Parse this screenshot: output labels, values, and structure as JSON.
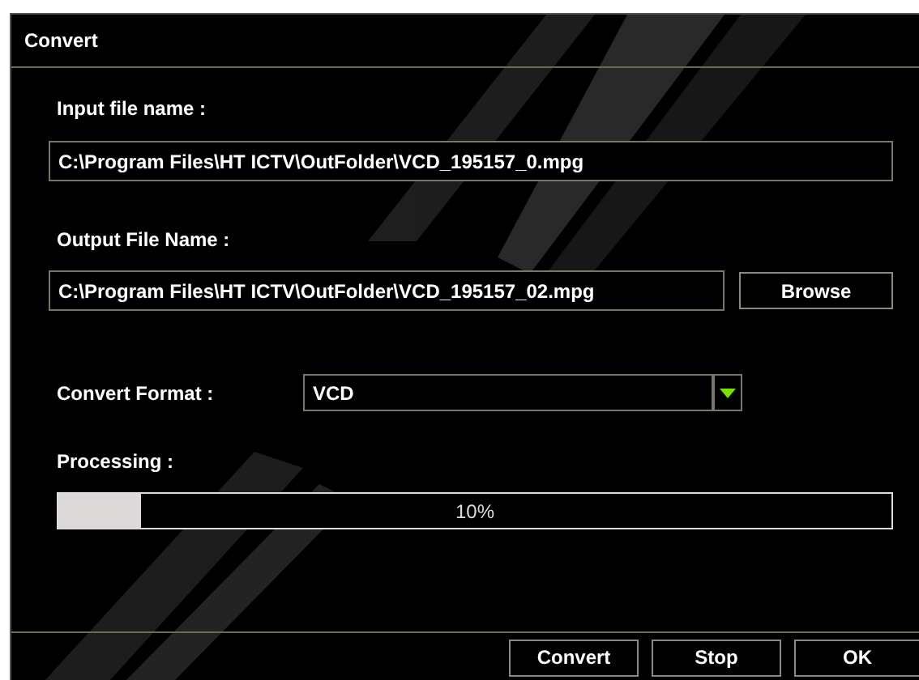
{
  "window": {
    "title": "Convert"
  },
  "input_file": {
    "label": "Input file name :",
    "value": "C:\\Program Files\\HT ICTV\\OutFolder\\VCD_195157_0.mpg"
  },
  "output_file": {
    "label": "Output File Name :",
    "value": "C:\\Program Files\\HT ICTV\\OutFolder\\VCD_195157_02.mpg",
    "button": "Browse"
  },
  "convert_format": {
    "label": "Convert Format :",
    "value": "VCD"
  },
  "processing": {
    "label": "Processing :",
    "level": 0.1,
    "reading": "10%"
  },
  "buttons": [
    "Convert",
    "Stop",
    "OK"
  ]
}
